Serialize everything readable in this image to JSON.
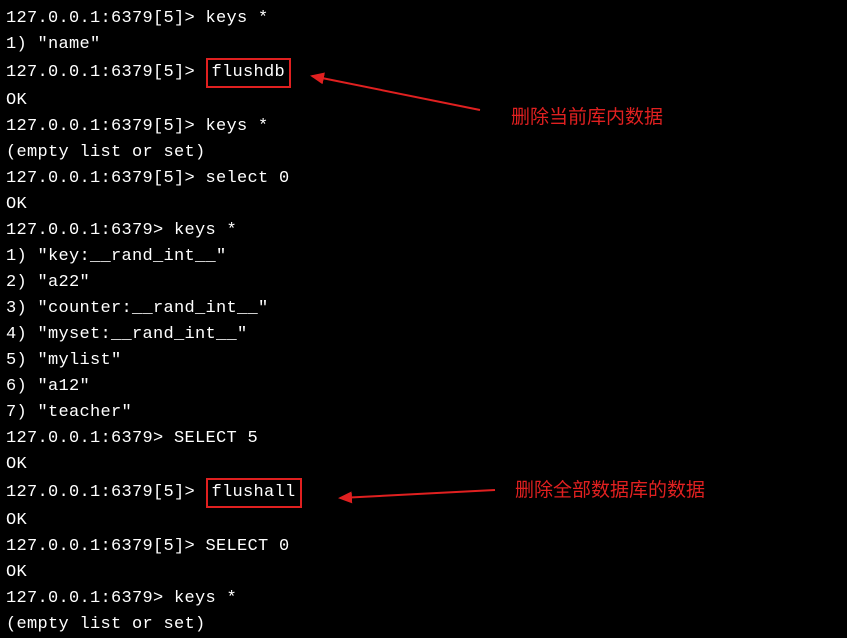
{
  "terminal": {
    "prompt1": "127.0.0.1:6379[5]> ",
    "prompt2": "127.0.0.1:6379> ",
    "cmd_keys": "keys *",
    "cmd_flushdb": "flushdb",
    "cmd_select0": "select 0",
    "cmd_select5u": "SELECT 5",
    "cmd_select0u": "SELECT 0",
    "cmd_flushall": "flushall",
    "resp_ok": "OK",
    "resp_empty": "(empty list or set)",
    "row1": "1) \"name\"",
    "kr1": "1) \"key:__rand_int__\"",
    "kr2": "2) \"a22\"",
    "kr3": "3) \"counter:__rand_int__\"",
    "kr4": "4) \"myset:__rand_int__\"",
    "kr5": "5) \"mylist\"",
    "kr6": "6) \"a12\"",
    "kr7": "7) \"teacher\""
  },
  "annotations": {
    "label1": "删除当前库内数据",
    "label2": "删除全部数据库的数据"
  }
}
